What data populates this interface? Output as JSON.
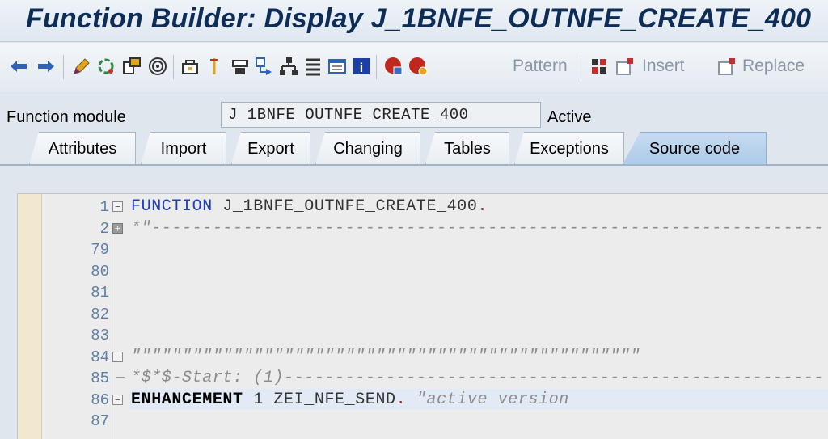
{
  "window": {
    "title": "Function Builder: Display J_1BNFE_OUTNFE_CREATE_400"
  },
  "toolbar": {
    "icons": [
      "back-arrow-icon",
      "forward-arrow-icon",
      "edit-pencil-icon",
      "display-change-icon",
      "other-object-icon",
      "where-used-icon",
      "activate-icon",
      "check-icon",
      "test-icon",
      "navigate-icon",
      "hierarchy-icon",
      "object-list-icon",
      "window-list-icon",
      "help-info-icon",
      "breakpoint-icon",
      "session-breakpoint-icon",
      "insert-icon",
      "replace-icon",
      "pattern-icon"
    ],
    "pattern_label": "Pattern",
    "insert_label": "Insert",
    "replace_label": "Replace"
  },
  "header": {
    "function_module_label": "Function module",
    "function_module_value": "J_1BNFE_OUTNFE_CREATE_400",
    "status": "Active"
  },
  "tabs": [
    {
      "label": "Attributes",
      "active": false
    },
    {
      "label": "Import",
      "active": false
    },
    {
      "label": "Export",
      "active": false
    },
    {
      "label": "Changing",
      "active": false
    },
    {
      "label": "Tables",
      "active": false
    },
    {
      "label": "Exceptions",
      "active": false
    },
    {
      "label": "Source code",
      "active": true
    }
  ],
  "editor": {
    "lines": [
      {
        "num": "1",
        "kw": "FUNCTION",
        "rest": " J_1BNFE_OUTNFE_CREATE_400",
        "dot": "."
      },
      {
        "num": "2",
        "comment": "*\"----------------------------------------------------------------------"
      },
      {
        "num": "79"
      },
      {
        "num": "80"
      },
      {
        "num": "81"
      },
      {
        "num": "82"
      },
      {
        "num": "83"
      },
      {
        "num": "84",
        "comment": "\"\"\"\"\"\"\"\"\"\"\"\"\"\"\"\"\"\"\"\"\"\"\"\"\"\"\"\"\"\"\"\"\"\"\"\"\"\"\"\"\"\"\"\"\"\"\"\"\"\""
      },
      {
        "num": "85",
        "comment": "*$*$-Start: (1)--------------------------------------------------------"
      },
      {
        "num": "86",
        "kw": "ENHANCEMENT",
        "rest": " 1  ZEI_NFE_SEND",
        "dot": ".",
        "comment": "    \"active version"
      },
      {
        "num": "87"
      }
    ]
  },
  "colors": {
    "accent": "#1d3fc4",
    "active_tab": "#aecbe8",
    "gutter": "#f1e8cf"
  }
}
